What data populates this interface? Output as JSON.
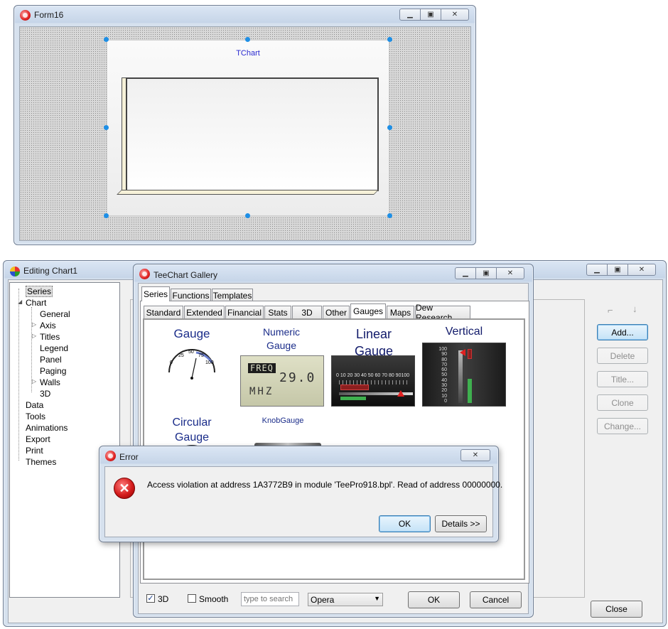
{
  "form16": {
    "title": "Form16",
    "chart_label": "TChart"
  },
  "editor": {
    "title": "Editing Chart1",
    "tree": [
      {
        "label": "Series",
        "level": 0,
        "selected": true
      },
      {
        "label": "Chart",
        "level": 0,
        "expander": "open"
      },
      {
        "label": "General",
        "level": 1
      },
      {
        "label": "Axis",
        "level": 1,
        "expander": "closed"
      },
      {
        "label": "Titles",
        "level": 1,
        "expander": "closed"
      },
      {
        "label": "Legend",
        "level": 1
      },
      {
        "label": "Panel",
        "level": 1
      },
      {
        "label": "Paging",
        "level": 1
      },
      {
        "label": "Walls",
        "level": 1,
        "expander": "closed"
      },
      {
        "label": "3D",
        "level": 1
      },
      {
        "label": "Data",
        "level": 0
      },
      {
        "label": "Tools",
        "level": 0
      },
      {
        "label": "Animations",
        "level": 0
      },
      {
        "label": "Export",
        "level": 0
      },
      {
        "label": "Print",
        "level": 0
      },
      {
        "label": "Themes",
        "level": 0
      }
    ],
    "buttons": {
      "add": "Add...",
      "delete": "Delete",
      "title": "Title...",
      "clone": "Clone",
      "change": "Change...",
      "close": "Close"
    }
  },
  "gallery": {
    "title": "TeeChart Gallery",
    "top_tabs": [
      "Series",
      "Functions",
      "Templates"
    ],
    "sub_tabs": [
      "Standard",
      "Extended",
      "Financial",
      "Stats",
      "3D",
      "Other",
      "Gauges",
      "Maps",
      "Dew Research"
    ],
    "items": {
      "gauge": "Gauge",
      "numeric_l1": "Numeric",
      "numeric_l2": "Gauge",
      "linear_l1": "Linear",
      "linear_l2": "Gauge",
      "vertical": "Vertical",
      "circular_l1": "Circular",
      "circular_l2": "Gauge",
      "knob": "KnobGauge"
    },
    "gauge_ticks": [
      "0",
      "25",
      "50",
      "75",
      "100"
    ],
    "lcd": {
      "tag": "FREQ",
      "value": "29.0",
      "unit": "MHZ"
    },
    "linear_ticks": "0 10 20 30 40 50 60 70 80 90100",
    "vertical_ticks": [
      "100",
      "90",
      "80",
      "70",
      "60",
      "50",
      "40",
      "30",
      "20",
      "10",
      "0"
    ],
    "bottom": {
      "check_3d": "3D",
      "check_smooth": "Smooth",
      "search_placeholder": "type to search",
      "theme": "Opera",
      "ok": "OK",
      "cancel": "Cancel"
    }
  },
  "error": {
    "title": "Error",
    "message": "Access violation at address 1A3772B9 in module 'TeePro918.bpl'. Read of address 00000000.",
    "ok": "OK",
    "details": "Details >>"
  }
}
